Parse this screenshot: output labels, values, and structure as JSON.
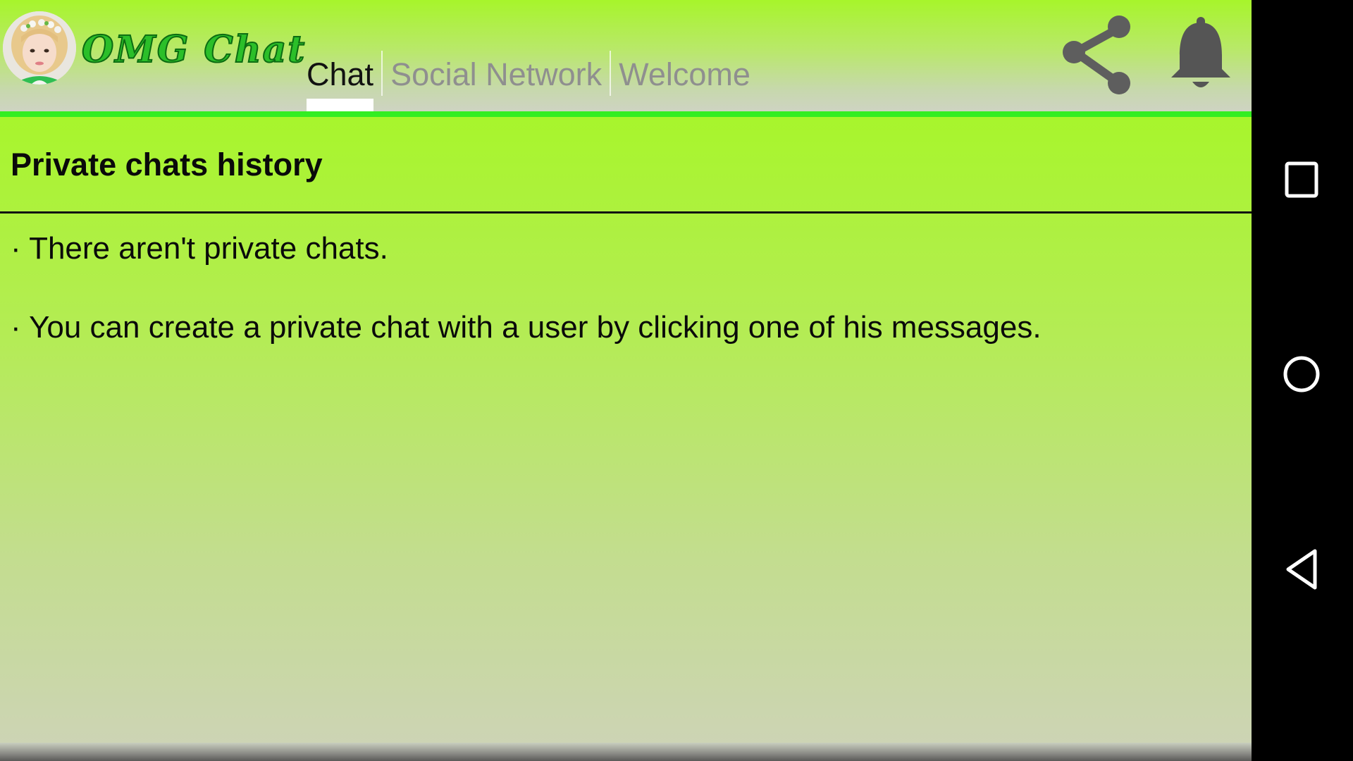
{
  "app": {
    "title": "OMG Chat"
  },
  "tabs": [
    {
      "label": "Chat",
      "active": true
    },
    {
      "label": "Social Network",
      "active": false
    },
    {
      "label": "Welcome",
      "active": false
    }
  ],
  "toolbar": {
    "share_icon": "share-icon",
    "notifications_icon": "bell-icon"
  },
  "section": {
    "title": "Private chats history"
  },
  "messages": [
    "· There aren't private chats.",
    "· You can create a private chat with a user by clicking one of his messages."
  ],
  "navbar": {
    "recents_icon": "square-icon",
    "home_icon": "circle-icon",
    "back_icon": "triangle-back-icon"
  },
  "colors": {
    "accent_green": "#33ee22",
    "logo_green": "#2bbf29",
    "header_top": "#a7f52b",
    "icon_gray": "#5c5c5c"
  }
}
